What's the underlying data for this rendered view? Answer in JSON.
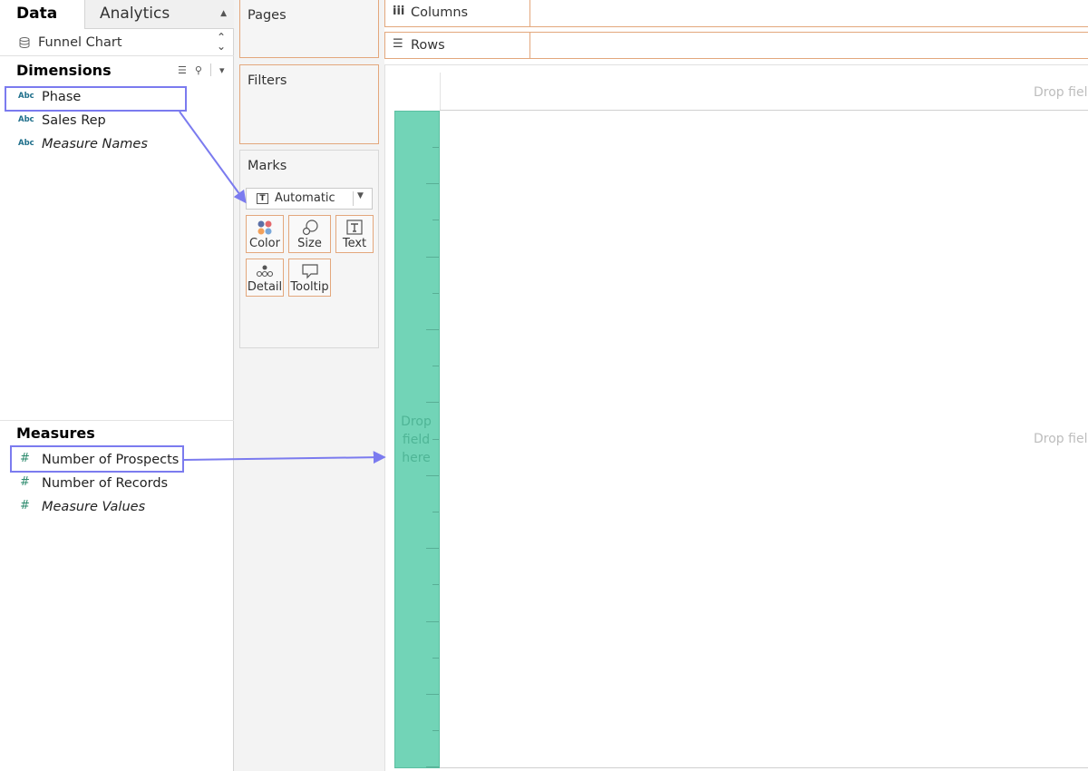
{
  "tabs": {
    "data": "Data",
    "analytics": "Analytics"
  },
  "datasource": {
    "name": "Funnel Chart"
  },
  "dimensions": {
    "title": "Dimensions",
    "items": [
      {
        "type_label": "Abc",
        "label": "Phase"
      },
      {
        "type_label": "Abc",
        "label": "Sales Rep"
      },
      {
        "type_label": "Abc",
        "label": "Measure Names"
      }
    ]
  },
  "measures": {
    "title": "Measures",
    "items": [
      {
        "type_label": "#",
        "label": "Number of Prospects"
      },
      {
        "type_label": "#",
        "label": "Number of Records"
      },
      {
        "type_label": "#",
        "label": "Measure Values"
      }
    ]
  },
  "cards": {
    "pages": "Pages",
    "filters": "Filters",
    "marks": "Marks"
  },
  "marks": {
    "type": "Automatic",
    "buttons": {
      "color": "Color",
      "size": "Size",
      "text": "Text",
      "detail": "Detail",
      "tooltip": "Tooltip"
    }
  },
  "shelves": {
    "columns": "Columns",
    "rows": "Rows"
  },
  "view": {
    "drop_hint_top": "Drop fiel",
    "drop_hint_mid": "Drop fiel",
    "band_drop_hint": [
      "Drop",
      "field",
      "here"
    ],
    "band_color": "#72d4b7"
  },
  "annotation_color": "#7b7bef"
}
